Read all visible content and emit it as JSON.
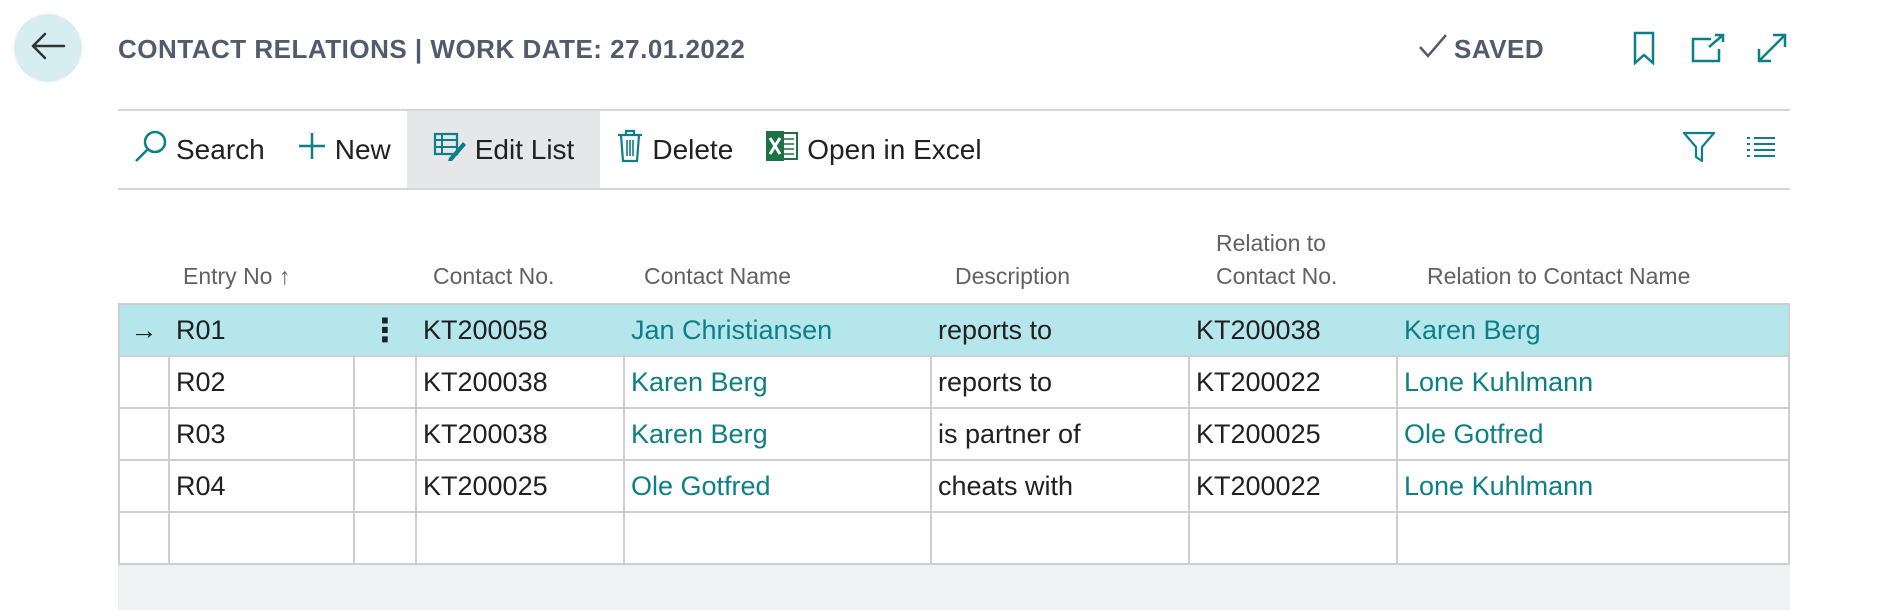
{
  "header": {
    "title": "CONTACT RELATIONS | WORK DATE: 27.01.2022",
    "saved_label": "SAVED",
    "icons": [
      "back-arrow-icon",
      "checkmark-icon",
      "bookmark-icon",
      "open-new-window-icon",
      "expand-icon"
    ]
  },
  "toolbar": {
    "search_label": "Search",
    "new_label": "New",
    "edit_list_label": "Edit List",
    "delete_label": "Delete",
    "excel_label": "Open in Excel"
  },
  "table": {
    "headers": {
      "entry_no": "Entry No",
      "contact_no": "Contact No.",
      "contact_name": "Contact Name",
      "description": "Description",
      "relation_no_line1": "Relation to",
      "relation_no_line2": "Contact No.",
      "relation_name": "Relation to Contact Name"
    },
    "sort_indicator": "↑",
    "rows": [
      {
        "entry_no": "R01",
        "contact_no": "KT200058",
        "contact_name": "Jan Christiansen",
        "description": "reports to",
        "relation_no": "KT200038",
        "relation_name": "Karen Berg"
      },
      {
        "entry_no": "R02",
        "contact_no": "KT200038",
        "contact_name": "Karen Berg",
        "description": "reports to",
        "relation_no": "KT200022",
        "relation_name": "Lone Kuhlmann"
      },
      {
        "entry_no": "R03",
        "contact_no": "KT200038",
        "contact_name": "Karen Berg",
        "description": "is partner of",
        "relation_no": "KT200025",
        "relation_name": "Ole Gotfred"
      },
      {
        "entry_no": "R04",
        "contact_no": "KT200025",
        "contact_name": "Ole Gotfred",
        "description": "cheats with",
        "relation_no": "KT200022",
        "relation_name": "Lone Kuhlmann"
      }
    ],
    "selected_row_marker": "→",
    "row_menu_glyph": "⋮"
  },
  "colors": {
    "accent": "#0d7f86",
    "selected_row": "#b5e6ec",
    "back_button": "#d6eef2",
    "excel_green": "#1e7145"
  }
}
